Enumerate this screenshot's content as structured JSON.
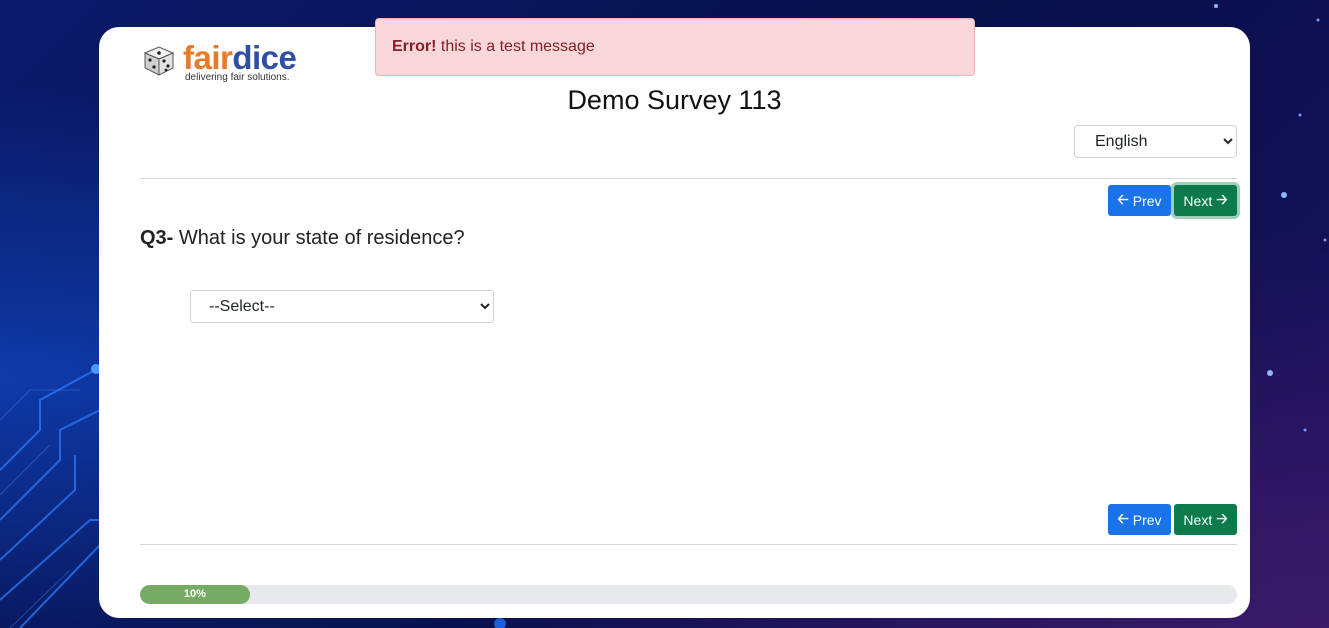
{
  "brand": {
    "name_part1": "fair",
    "name_part2": "dice",
    "tagline": "delivering fair solutions.",
    "color_fair": "#e87a2a",
    "color_dice": "#2e4fa3"
  },
  "alert": {
    "type": "error",
    "strong": "Error!",
    "message": "this is a test message"
  },
  "survey": {
    "title": "Demo Survey 113"
  },
  "language": {
    "selected": "English"
  },
  "nav": {
    "prev_label": "Prev",
    "next_label": "Next",
    "prev_icon": "arrow-left-icon",
    "next_icon": "arrow-right-icon"
  },
  "question": {
    "number": "Q3-",
    "text": "What is your state of residence?",
    "select_value": "--Select--"
  },
  "progress": {
    "percent": 10,
    "label": "10%"
  },
  "colors": {
    "prev_button": "#1a73e8",
    "next_button": "#0d7a4c",
    "progress_fill": "#76ab66",
    "alert_bg": "#f8d7da"
  }
}
